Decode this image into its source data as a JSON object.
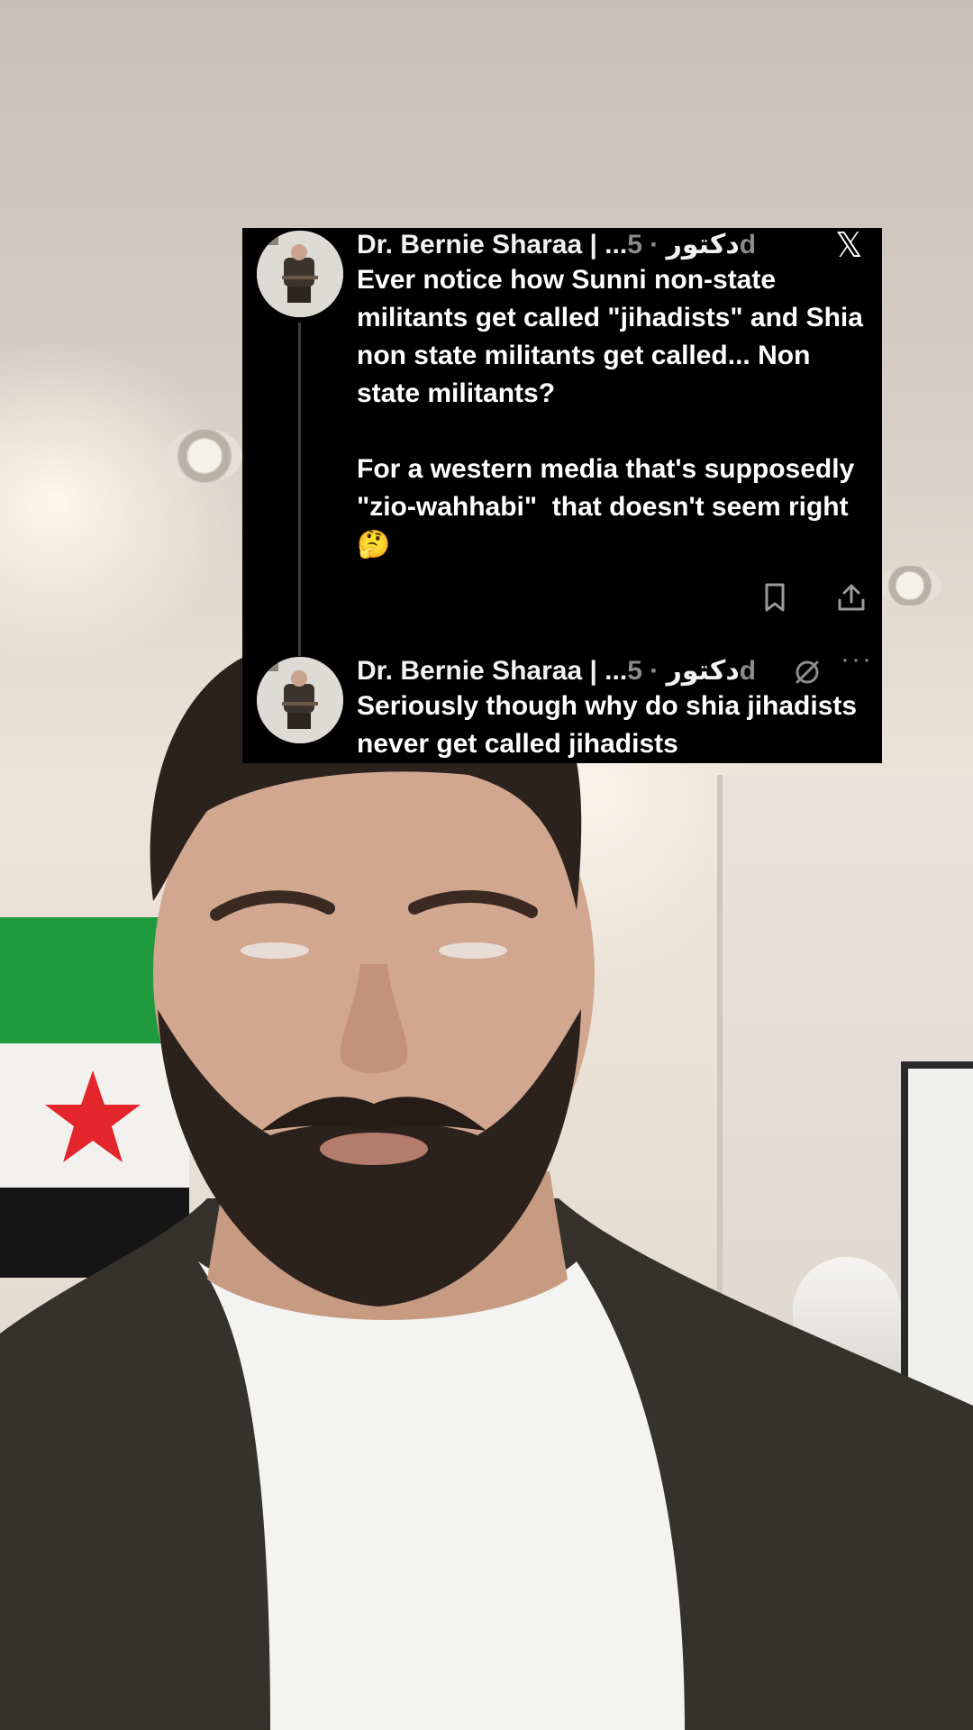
{
  "tweets": [
    {
      "author": "Dr. Bernie Sharaa | ...دكتور",
      "separator": "·",
      "time": "5d",
      "text": "Ever notice how Sunni non-state militants get called \"jihadists\" and Shia non state militants get called... Non state militants?\n\nFor a western media that's supposedly \"zio-wahhabi\"  that doesn't seem right 🤔"
    },
    {
      "author": "Dr. Bernie Sharaa | ...دكتور",
      "separator": "·",
      "time": "5d",
      "text": "Seriously though why do shia jihadists never get called jihadists"
    }
  ],
  "icons": {
    "platform": "x-logo-icon",
    "bookmark": "bookmark-icon",
    "share": "share-icon",
    "grok": "grok-icon",
    "more": "more-options-icon"
  },
  "more_label": "···",
  "x_logo_glyph": "𝕏"
}
